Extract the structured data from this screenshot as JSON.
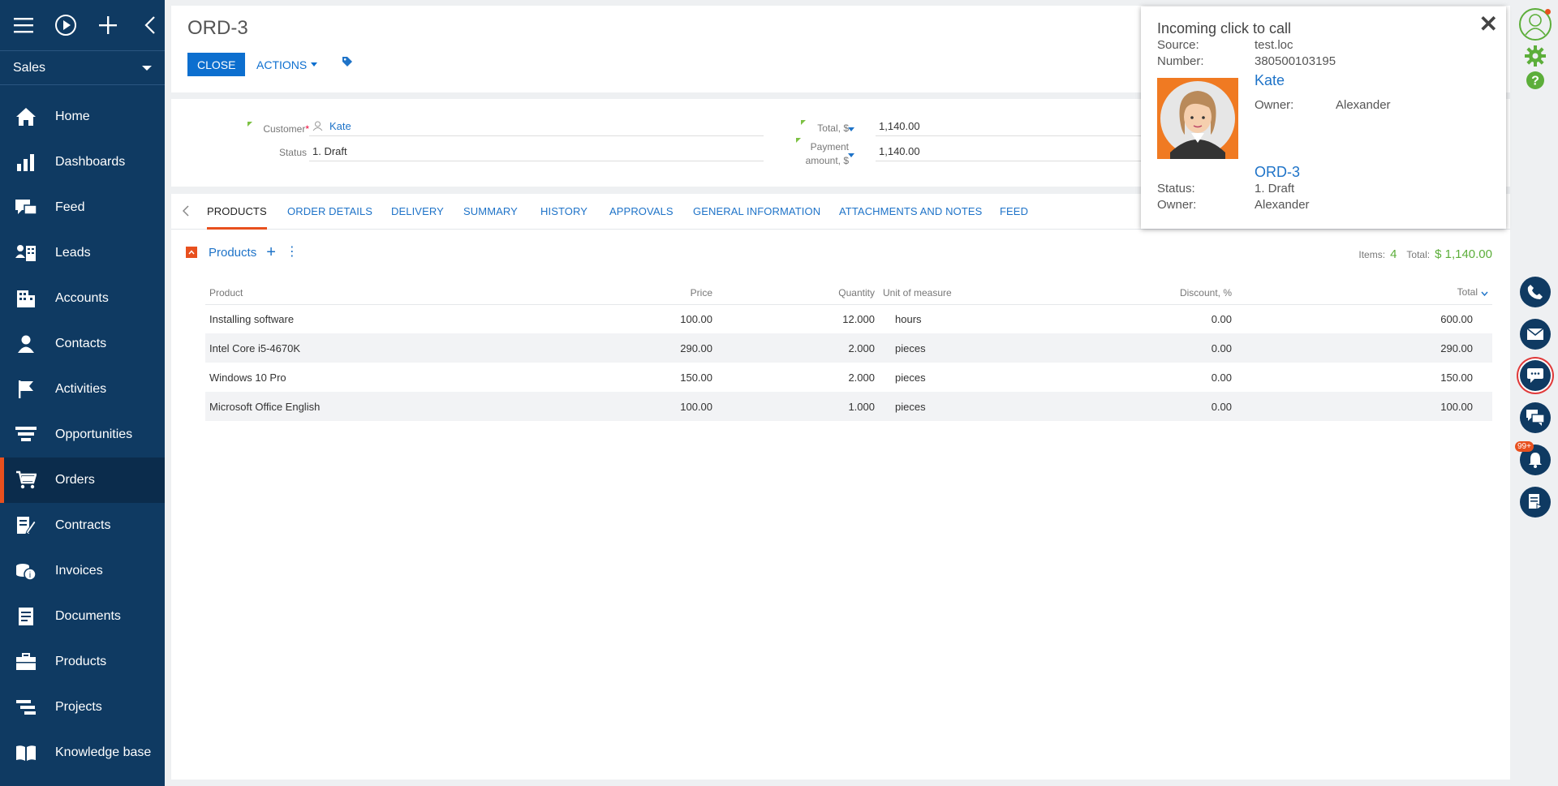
{
  "sidebar": {
    "workspace": "Sales",
    "items": [
      {
        "label": "Home",
        "icon": "home-icon"
      },
      {
        "label": "Dashboards",
        "icon": "chart-icon"
      },
      {
        "label": "Feed",
        "icon": "feed-icon"
      },
      {
        "label": "Leads",
        "icon": "leads-icon"
      },
      {
        "label": "Accounts",
        "icon": "building-icon"
      },
      {
        "label": "Contacts",
        "icon": "person-icon"
      },
      {
        "label": "Activities",
        "icon": "flag-icon"
      },
      {
        "label": "Opportunities",
        "icon": "funnel-icon"
      },
      {
        "label": "Orders",
        "icon": "cart-icon"
      },
      {
        "label": "Contracts",
        "icon": "contract-icon"
      },
      {
        "label": "Invoices",
        "icon": "coins-icon"
      },
      {
        "label": "Documents",
        "icon": "document-icon"
      },
      {
        "label": "Products",
        "icon": "briefcase-icon"
      },
      {
        "label": "Projects",
        "icon": "projects-icon"
      },
      {
        "label": "Knowledge base",
        "icon": "book-icon"
      }
    ],
    "active_item": "Orders"
  },
  "header": {
    "title": "ORD-3",
    "close_label": "CLOSE",
    "actions_label": "ACTIONS"
  },
  "fields": {
    "customer_label": "Customer",
    "customer_required": "*",
    "customer_value": "Kate",
    "status_label": "Status",
    "status_value": "1. Draft",
    "total_label": "Total, $",
    "total_value": "1,140.00",
    "payment_label_1": "Payment",
    "payment_label_2": "amount, $",
    "payment_value": "1,140.00"
  },
  "tabs": [
    "PRODUCTS",
    "ORDER DETAILS",
    "DELIVERY",
    "SUMMARY",
    "HISTORY",
    "APPROVALS",
    "GENERAL INFORMATION",
    "ATTACHMENTS AND NOTES",
    "FEED"
  ],
  "products": {
    "title": "Products",
    "items_label": "Items:",
    "items_count": "4",
    "total_label": "Total:",
    "total_value": "$ 1,140.00",
    "columns": [
      "Product",
      "Price",
      "Quantity",
      "Unit of measure",
      "Discount, %",
      "Total"
    ],
    "rows": [
      {
        "product": "Installing software",
        "price": "100.00",
        "quantity": "12.000",
        "unit": "hours",
        "discount": "0.00",
        "total": "600.00"
      },
      {
        "product": "Intel Core i5-4670K",
        "price": "290.00",
        "quantity": "2.000",
        "unit": "pieces",
        "discount": "0.00",
        "total": "290.00"
      },
      {
        "product": "Windows 10 Pro",
        "price": "150.00",
        "quantity": "2.000",
        "unit": "pieces",
        "discount": "0.00",
        "total": "150.00"
      },
      {
        "product": "Microsoft Office English",
        "price": "100.00",
        "quantity": "1.000",
        "unit": "pieces",
        "discount": "0.00",
        "total": "100.00"
      }
    ]
  },
  "popup": {
    "title": "Incoming click to call",
    "source_label": "Source:",
    "source_value": "test.loc",
    "number_label": "Number:",
    "number_value": "380500103195",
    "contact_name": "Kate",
    "contact_owner_label": "Owner:",
    "contact_owner_value": "Alexander",
    "order_name": "ORD-3",
    "order_status_label": "Status:",
    "order_status_value": "1. Draft",
    "order_owner_label": "Owner:",
    "order_owner_value": "Alexander"
  },
  "rightbar": {
    "notifications_badge": "99+"
  },
  "colors": {
    "sidebar_bg": "#0f3a62",
    "accent": "#e8501e",
    "link": "#1e73c8",
    "primary_button": "#0d6fcf",
    "success": "#5cae3a"
  }
}
